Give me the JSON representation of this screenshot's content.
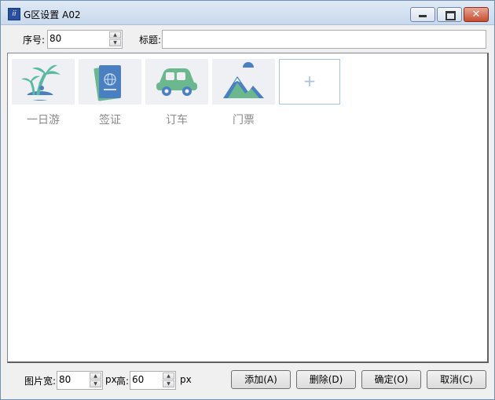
{
  "window": {
    "title": "G区设置 A02",
    "close_glyph": "✕"
  },
  "header": {
    "index_label": "序号:",
    "index_value": "80",
    "title_label": "标题:",
    "title_value": ""
  },
  "tiles": [
    {
      "label": "一日游",
      "icon": "palm-island-icon"
    },
    {
      "label": "签证",
      "icon": "passport-icon"
    },
    {
      "label": "订车",
      "icon": "car-icon"
    },
    {
      "label": "门票",
      "icon": "mountain-icon"
    }
  ],
  "add_tile": {
    "glyph": "+"
  },
  "footer": {
    "width_label": "图片宽:",
    "width_value": "80",
    "unit_px_1": "px",
    "height_label": "高:",
    "height_value": "60",
    "unit_px_2": "px",
    "add_button": "添加(A)",
    "delete_button": "删除(D)",
    "ok_button": "确定(O)",
    "cancel_button": "取消(C)"
  },
  "colors": {
    "icon_teal": "#5ab9a3",
    "icon_blue": "#4a7fc1",
    "icon_green": "#6bb88f",
    "tile_bg": "#eef0f3",
    "label_gray": "#8a8a8a"
  }
}
